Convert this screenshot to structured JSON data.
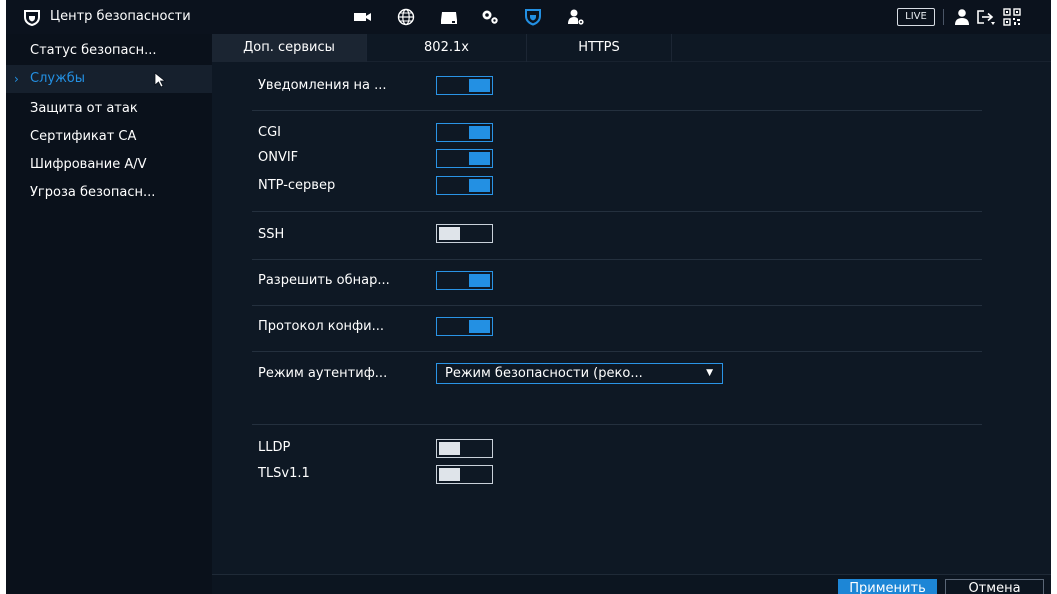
{
  "header": {
    "title": "Центр безопасности",
    "live_label": "LIVE",
    "icons": [
      "camera-icon",
      "globe-icon",
      "storage-icon",
      "settings-icon",
      "security-shield-icon",
      "account-settings-icon",
      "user-icon",
      "logout-icon",
      "qr-code-icon"
    ]
  },
  "sidebar": {
    "items": [
      {
        "label": "Статус безопасн..."
      },
      {
        "label": "Службы",
        "active": true
      },
      {
        "label": "Защита от атак"
      },
      {
        "label": "Сертификат CA"
      },
      {
        "label": "Шифрование A/V"
      },
      {
        "label": "Угроза безопасн..."
      }
    ]
  },
  "tabs": [
    {
      "label": "Доп. сервисы",
      "active": true
    },
    {
      "label": "802.1x"
    },
    {
      "label": "HTTPS"
    }
  ],
  "settings": {
    "notifications": {
      "label": "Уведомления на ...",
      "on": true
    },
    "cgi": {
      "label": "CGI",
      "on": true
    },
    "onvif": {
      "label": "ONVIF",
      "on": true
    },
    "ntp": {
      "label": "NTP-сервер",
      "on": true
    },
    "ssh": {
      "label": "SSH",
      "on": false
    },
    "discovery": {
      "label": "Разрешить обнар...",
      "on": true
    },
    "config_protocol": {
      "label": "Протокол конфи...",
      "on": true
    },
    "auth_mode": {
      "label": "Режим аутентиф...",
      "value": "Режим безопасности (реко..."
    },
    "lldp": {
      "label": "LLDP",
      "on": false
    },
    "tls": {
      "label": "TLSv1.1",
      "on": false
    }
  },
  "footer": {
    "apply_label": "Применить",
    "cancel_label": "Отмена"
  },
  "colors": {
    "accent": "#2390e3",
    "background": "#0e1824",
    "sidebar": "#0a111b"
  }
}
